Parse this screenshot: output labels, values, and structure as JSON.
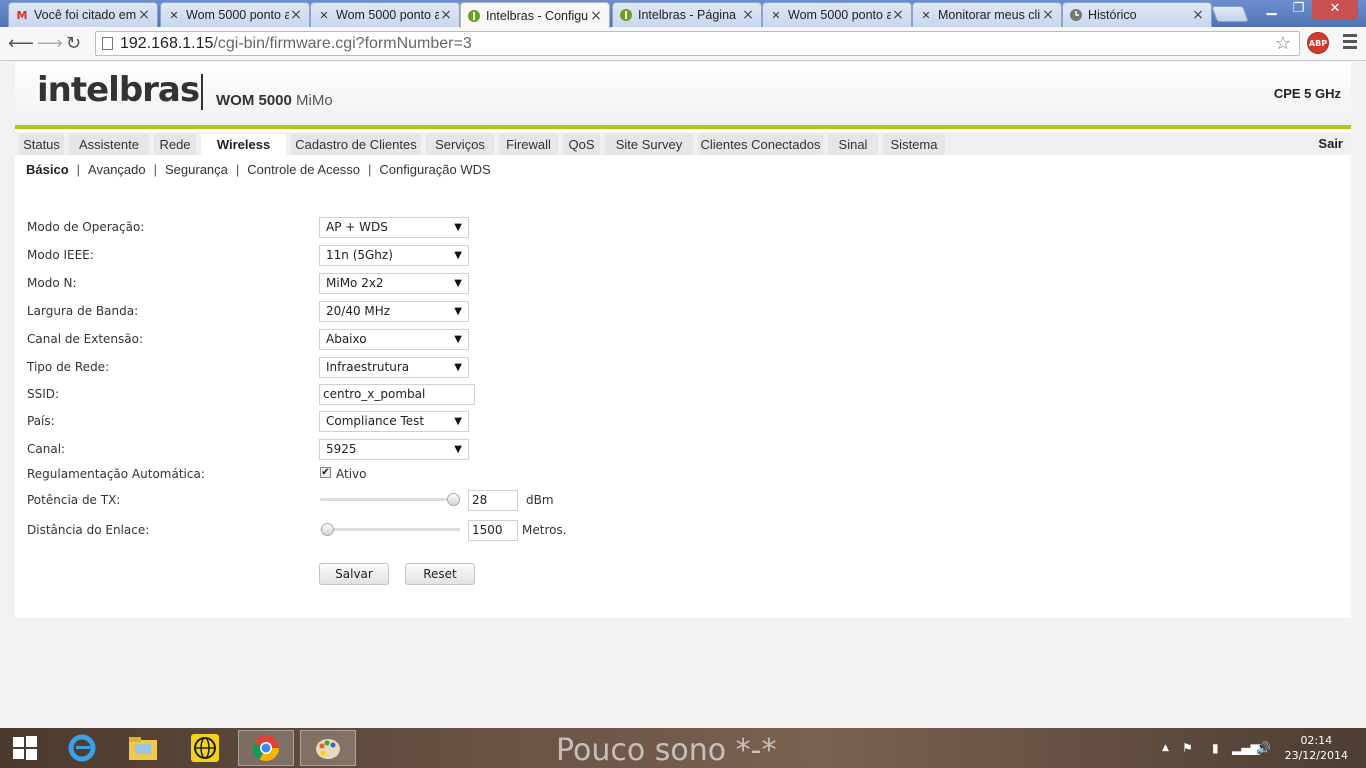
{
  "browser": {
    "tabs": [
      {
        "title": "Você foi citado em",
        "icon": "gmail-icon"
      },
      {
        "title": "Wom 5000 ponto a",
        "icon": "x-icon"
      },
      {
        "title": "Wom 5000 ponto a",
        "icon": "x-icon"
      },
      {
        "title": "Intelbras - Configu",
        "icon": "intelbras-icon"
      },
      {
        "title": "Intelbras - Página",
        "icon": "intelbras-icon"
      },
      {
        "title": "Wom 5000 ponto a",
        "icon": "x-icon"
      },
      {
        "title": "Monitorar meus cli",
        "icon": "x-icon"
      },
      {
        "title": "Histórico",
        "icon": "history-icon"
      }
    ],
    "active_tab_index": 3,
    "url_host": "192.168.1.15",
    "url_path": "/cgi-bin/firmware.cgi?formNumber=3",
    "abp_label": "ABP"
  },
  "header": {
    "logo": "intelbras",
    "product_bold": "WOM 5000",
    "product_sub": "MiMo",
    "device_type": "CPE 5 GHz",
    "accent_color": "#b5c415"
  },
  "main_nav": {
    "items": [
      "Status",
      "Assistente",
      "Rede",
      "Wireless",
      "Cadastro de Clientes",
      "Serviços",
      "Firewall",
      "QoS",
      "Site Survey",
      "Clientes Conectados",
      "Sinal",
      "Sistema"
    ],
    "active": "Wireless",
    "logout": "Sair"
  },
  "sub_nav": {
    "items": [
      "Básico",
      "Avançado",
      "Segurança",
      "Controle de Acesso",
      "Configuração WDS"
    ],
    "active": "Básico",
    "separator": "|"
  },
  "form": {
    "modo_operacao": {
      "label": "Modo de Operação:",
      "value": "AP + WDS"
    },
    "modo_ieee": {
      "label": "Modo IEEE:",
      "value": "11n (5Ghz)"
    },
    "modo_n": {
      "label": "Modo N:",
      "value": "MiMo 2x2"
    },
    "largura_banda": {
      "label": "Largura de Banda:",
      "value": "20/40 MHz"
    },
    "canal_extensao": {
      "label": "Canal de Extensão:",
      "value": "Abaixo"
    },
    "tipo_rede": {
      "label": "Tipo de Rede:",
      "value": "Infraestrutura"
    },
    "ssid": {
      "label": "SSID:",
      "value": "centro_x_pombal"
    },
    "pais": {
      "label": "País:",
      "value": "Compliance Test"
    },
    "canal": {
      "label": "Canal:",
      "value": "5925"
    },
    "regulamentacao": {
      "label": "Regulamentação Automática:",
      "checkbox_label": "Ativo",
      "checked": true
    },
    "potencia_tx": {
      "label": "Potência de TX:",
      "value": "28",
      "unit": "dBm",
      "slider_fraction": 0.95
    },
    "distancia": {
      "label": "Distância do Enlace:",
      "value": "1500",
      "unit": "Metros.",
      "slider_fraction": 0.05
    },
    "save_label": "Salvar",
    "reset_label": "Reset"
  },
  "taskbar": {
    "wallpaper_text": "Pouco sono *-*",
    "time": "02:14",
    "date": "23/12/2014"
  }
}
